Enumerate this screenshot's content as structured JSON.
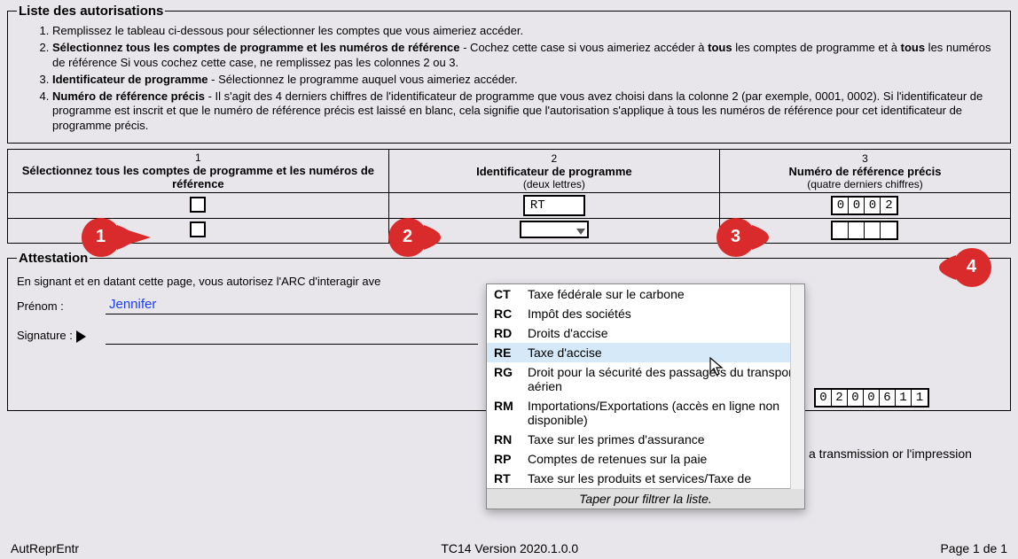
{
  "legend_autorisations": "Liste des autorisations",
  "instructions": {
    "i1": "Remplissez le tableau ci-dessous pour sélectionner les comptes que vous aimeriez accéder.",
    "i2_b1": "Sélectionnez tous les comptes de programme et les numéros de référence",
    "i2_rest1": " - Cochez cette case si vous aimeriez accéder à ",
    "i2_b2": "tous",
    "i2_rest2": " les comptes de programme et à ",
    "i2_b3": "tous",
    "i2_rest3": " les numéros de référence Si vous cochez cette case, ne remplissez pas les colonnes 2 ou 3.",
    "i3_b": "Identificateur de programme",
    "i3_rest": " - Sélectionnez le programme auquel vous aimeriez accéder.",
    "i4_b": "Numéro de référence précis",
    "i4_rest": " - Il s'agit des 4 derniers chiffres de l'identificateur de programme que vous avez choisi dans la colonne 2 (par exemple, 0001, 0002). Si l'identificateur de programme est inscrit et que le numéro de référence précis est laissé en blanc, cela signifie que l'autorisation s'applique à tous les numéros de référence pour cet identificateur de programme précis."
  },
  "table": {
    "c1_num": "1",
    "c1_head": "Sélectionnez tous les comptes de programme et les numéros de référence",
    "c2_num": "2",
    "c2_head": "Identificateur de programme",
    "c2_sub": "(deux lettres)",
    "c3_num": "3",
    "c3_head": "Numéro de référence précis",
    "c3_sub": "(quatre derniers chiffres)",
    "row1_ident": "RT",
    "row1_ref": [
      "0",
      "0",
      "0",
      "2"
    ]
  },
  "legend_attest": "Attestation",
  "attest_intro": "En signant et en datant cette page, vous autorisez l'ARC d'interagir ave",
  "prenom_label": "Prénom :",
  "prenom_value": "Jennifer",
  "signature_label": "Signature :",
  "date_digits": [
    "0",
    "2",
    "0",
    "0",
    "6",
    "1",
    "1"
  ],
  "behind": "a transmission or l'impression",
  "dropdown": {
    "options": [
      {
        "code": "CT",
        "label": "Taxe fédérale sur le carbone"
      },
      {
        "code": "RC",
        "label": "Impôt des sociétés"
      },
      {
        "code": "RD",
        "label": "Droits d'accise"
      },
      {
        "code": "RE",
        "label": "Taxe d'accise"
      },
      {
        "code": "RG",
        "label": "Droit pour la sécurité des passagers du transport aérien"
      },
      {
        "code": "RM",
        "label": "Importations/Exportations (accès en ligne non disponible)"
      },
      {
        "code": "RN",
        "label": "Taxe sur les primes d'assurance"
      },
      {
        "code": "RP",
        "label": "Comptes de retenues sur la paie"
      },
      {
        "code": "RT",
        "label": "Taxe sur les produits et services/Taxe de"
      }
    ],
    "hint": "Taper pour filtrer la liste."
  },
  "pins": {
    "p1": "1",
    "p2": "2",
    "p3": "3",
    "p4": "4"
  },
  "footer": {
    "left": "AutReprEntr",
    "center": "TC14 Version 2020.1.0.0",
    "right": "Page 1 de 1"
  }
}
